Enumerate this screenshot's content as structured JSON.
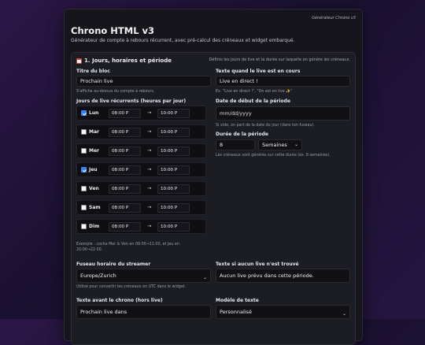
{
  "badge": "Générateur Chrono v3",
  "title": "Chrono HTML v3",
  "subtitle": "Générateur de compte à rebours récurrent, avec pré-calcul des créneaux et widget embarqué.",
  "section": {
    "heading": "1. Jours, horaires et période",
    "note": "Définis les jours de live et la durée sur laquelle on génère les créneaux."
  },
  "block_title": {
    "label": "Titre du bloc",
    "value": "Prochain live",
    "hint": "S'affiche au-dessus du compte à rebours."
  },
  "live_text": {
    "label": "Texte quand le live est en cours",
    "value": "Live en direct !",
    "hint": "Ex. \"Live en direct !\", \"On est en live ✨\""
  },
  "recurring": {
    "label": "Jours de live récurrents (heures par jour)",
    "arrow": "→",
    "days": [
      {
        "name": "Lun",
        "checked": true,
        "start": "08:00 P",
        "end": "10:00 P"
      },
      {
        "name": "Mar",
        "checked": false,
        "start": "08:00 P",
        "end": "10:00 P"
      },
      {
        "name": "Mer",
        "checked": false,
        "start": "08:00 P",
        "end": "10:00 P"
      },
      {
        "name": "Jeu",
        "checked": true,
        "start": "08:00 P",
        "end": "10:00 P"
      },
      {
        "name": "Ven",
        "checked": false,
        "start": "08:00 P",
        "end": "10:00 P"
      },
      {
        "name": "Sam",
        "checked": false,
        "start": "08:00 P",
        "end": "10:00 P"
      },
      {
        "name": "Dim",
        "checked": false,
        "start": "08:00 P",
        "end": "10:00 P"
      }
    ],
    "example": "Exemple : coche Mer & Ven en 09:00→11:00, et Jeu en 20:00→22:00."
  },
  "start_date": {
    "label": "Date de début de la période",
    "placeholder": "mm/dd/yyyy",
    "hint": "Si vide, on part de la date du jour (dans ton fuseau)."
  },
  "duration": {
    "label": "Durée de la période",
    "value": "8",
    "unit": "Semaines",
    "hint": "Les créneaux sont générés sur cette durée (ex. 8 semaines)."
  },
  "timezone": {
    "label": "Fuseau horaire du streamer",
    "value": "Europe/Zurich",
    "hint": "Utilisé pour convertir les créneaux en UTC dans le widget."
  },
  "no_live": {
    "label": "Texte si aucun live n'est trouvé",
    "value": "Aucun live prévu dans cette période."
  },
  "before_chrono": {
    "label": "Texte avant le chrono (hors live)",
    "value": "Prochain live dans"
  },
  "text_model": {
    "label": "Modèle de texte",
    "value": "Personnalisé"
  },
  "chevron": "⌄"
}
